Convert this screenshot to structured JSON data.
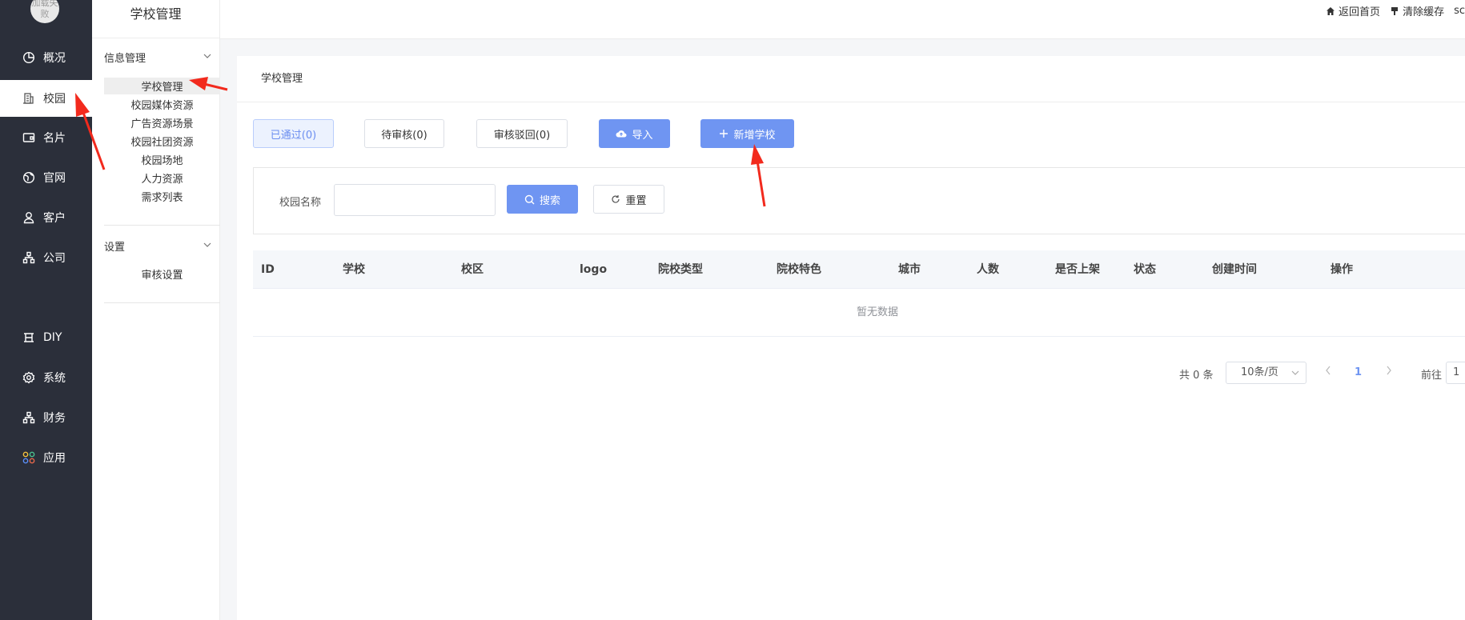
{
  "avatar": {
    "text": "加载失败"
  },
  "rail": {
    "items": [
      {
        "label": "概况",
        "icon": "pie-chart-icon"
      },
      {
        "label": "校园",
        "icon": "building-icon",
        "active": true
      },
      {
        "label": "名片",
        "icon": "card-icon"
      },
      {
        "label": "官网",
        "icon": "globe-icon"
      },
      {
        "label": "客户",
        "icon": "user-icon"
      },
      {
        "label": "公司",
        "icon": "org-icon"
      },
      {
        "label": "DIY",
        "icon": "diy-icon"
      },
      {
        "label": "系统",
        "icon": "gear-icon"
      },
      {
        "label": "财务",
        "icon": "finance-icon"
      },
      {
        "label": "应用",
        "icon": "apps-icon"
      }
    ]
  },
  "submenu": {
    "title": "学校管理",
    "group1": {
      "title": "信息管理",
      "items": [
        "学校管理",
        "校园媒体资源",
        "广告资源场景",
        "校园社团资源",
        "校园场地",
        "人力资源",
        "需求列表"
      ]
    },
    "group2": {
      "title": "设置",
      "items": [
        "审核设置"
      ]
    }
  },
  "header": {
    "home": "返回首页",
    "clear_cache": "清除缓存",
    "user": "sc"
  },
  "page": {
    "title": "学校管理",
    "tabs": [
      "已通过(0)",
      "待审核(0)",
      "审核驳回(0)"
    ],
    "import_label": "导入",
    "add_label": "新增学校",
    "search": {
      "label": "校园名称",
      "value": "",
      "search_label": "搜索",
      "reset_label": "重置"
    },
    "table": {
      "columns": [
        "ID",
        "学校",
        "校区",
        "logo",
        "院校类型",
        "院校特色",
        "城市",
        "人数",
        "是否上架",
        "状态",
        "创建时间",
        "操作"
      ],
      "empty": "暂无数据"
    },
    "pager": {
      "total": "共 0 条",
      "page_size": "10条/页",
      "current": "1",
      "goto": "前往",
      "goto_value": "1"
    }
  },
  "colors": {
    "rail_bg": "#2b2f3a",
    "primary": "#6f95f2",
    "annotation_arrow": "#f22a1d"
  }
}
